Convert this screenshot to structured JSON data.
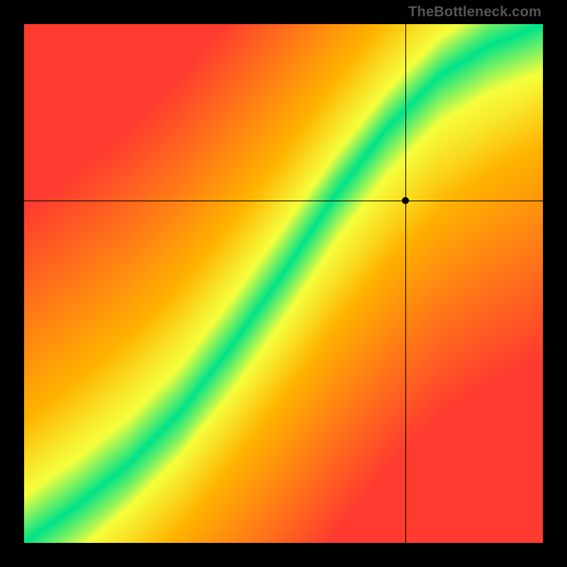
{
  "watermark": "TheBottleneck.com",
  "chart_data": {
    "type": "heatmap",
    "title": "",
    "xlabel": "",
    "ylabel": "",
    "xlim": [
      0,
      1
    ],
    "ylim": [
      0,
      1
    ],
    "grid": false,
    "legend": false,
    "crosshair": {
      "x": 0.735,
      "y": 0.66
    },
    "marker": {
      "x": 0.735,
      "y": 0.66
    },
    "ridge": {
      "description": "Locus of optimal (green) match between axes; diverging palette from red (poor) through yellow to green (optimal).",
      "points_xy": [
        [
          0.0,
          0.0
        ],
        [
          0.1,
          0.07
        ],
        [
          0.2,
          0.15
        ],
        [
          0.3,
          0.25
        ],
        [
          0.4,
          0.38
        ],
        [
          0.5,
          0.52
        ],
        [
          0.6,
          0.67
        ],
        [
          0.7,
          0.8
        ],
        [
          0.8,
          0.9
        ],
        [
          0.9,
          0.96
        ],
        [
          1.0,
          1.0
        ]
      ],
      "half_width_fraction": 0.06
    },
    "palette": {
      "optimal": "#00e388",
      "near": "#f5ff3d",
      "mid": "#ffb300",
      "far": "#ff3b30"
    }
  }
}
